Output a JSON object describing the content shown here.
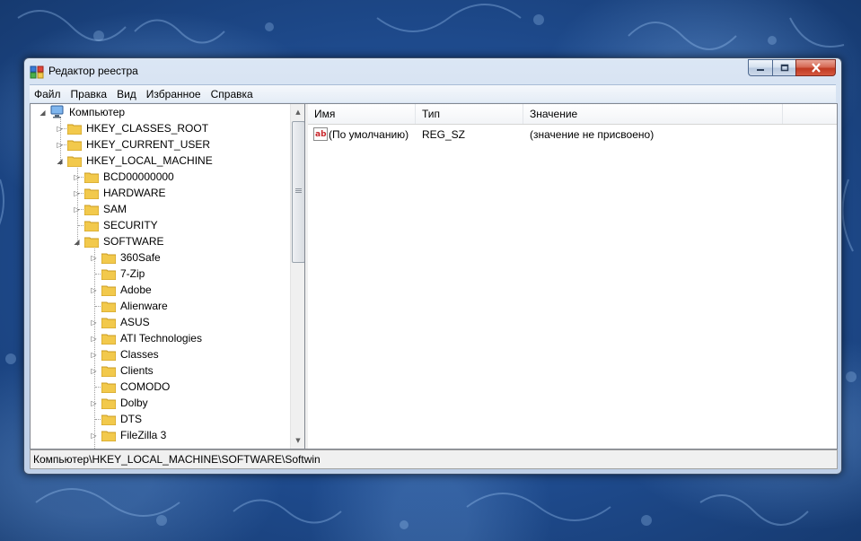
{
  "window": {
    "title": "Редактор реестра",
    "app_icon": "regedit-icon"
  },
  "caption_buttons": {
    "minimize": "minimize-icon",
    "maximize": "maximize-icon",
    "close": "close-icon"
  },
  "menu": [
    "Файл",
    "Правка",
    "Вид",
    "Избранное",
    "Справка"
  ],
  "tree": {
    "root": "Компьютер",
    "hives": [
      "HKEY_CLASSES_ROOT",
      "HKEY_CURRENT_USER",
      "HKEY_LOCAL_MACHINE"
    ],
    "hklm_children": [
      "BCD00000000",
      "HARDWARE",
      "SAM",
      "SECURITY",
      "SOFTWARE"
    ],
    "software_children": [
      "360Safe",
      "7-Zip",
      "Adobe",
      "Alienware",
      "ASUS",
      "ATI Technologies",
      "Classes",
      "Clients",
      "COMODO",
      "Dolby",
      "DTS",
      "FileZilla 3"
    ]
  },
  "list": {
    "columns": [
      "Имя",
      "Тип",
      "Значение"
    ],
    "rows": [
      {
        "name": "(По умолчанию)",
        "type": "REG_SZ",
        "value": "(значение не присвоено)",
        "icon": "string-value-icon"
      }
    ]
  },
  "status": {
    "path": "Компьютер\\HKEY_LOCAL_MACHINE\\SOFTWARE\\Softwin"
  },
  "colors": {
    "folder": "#f2c94c",
    "title_bg": "#c9d8ec",
    "close": "#c03a22"
  }
}
